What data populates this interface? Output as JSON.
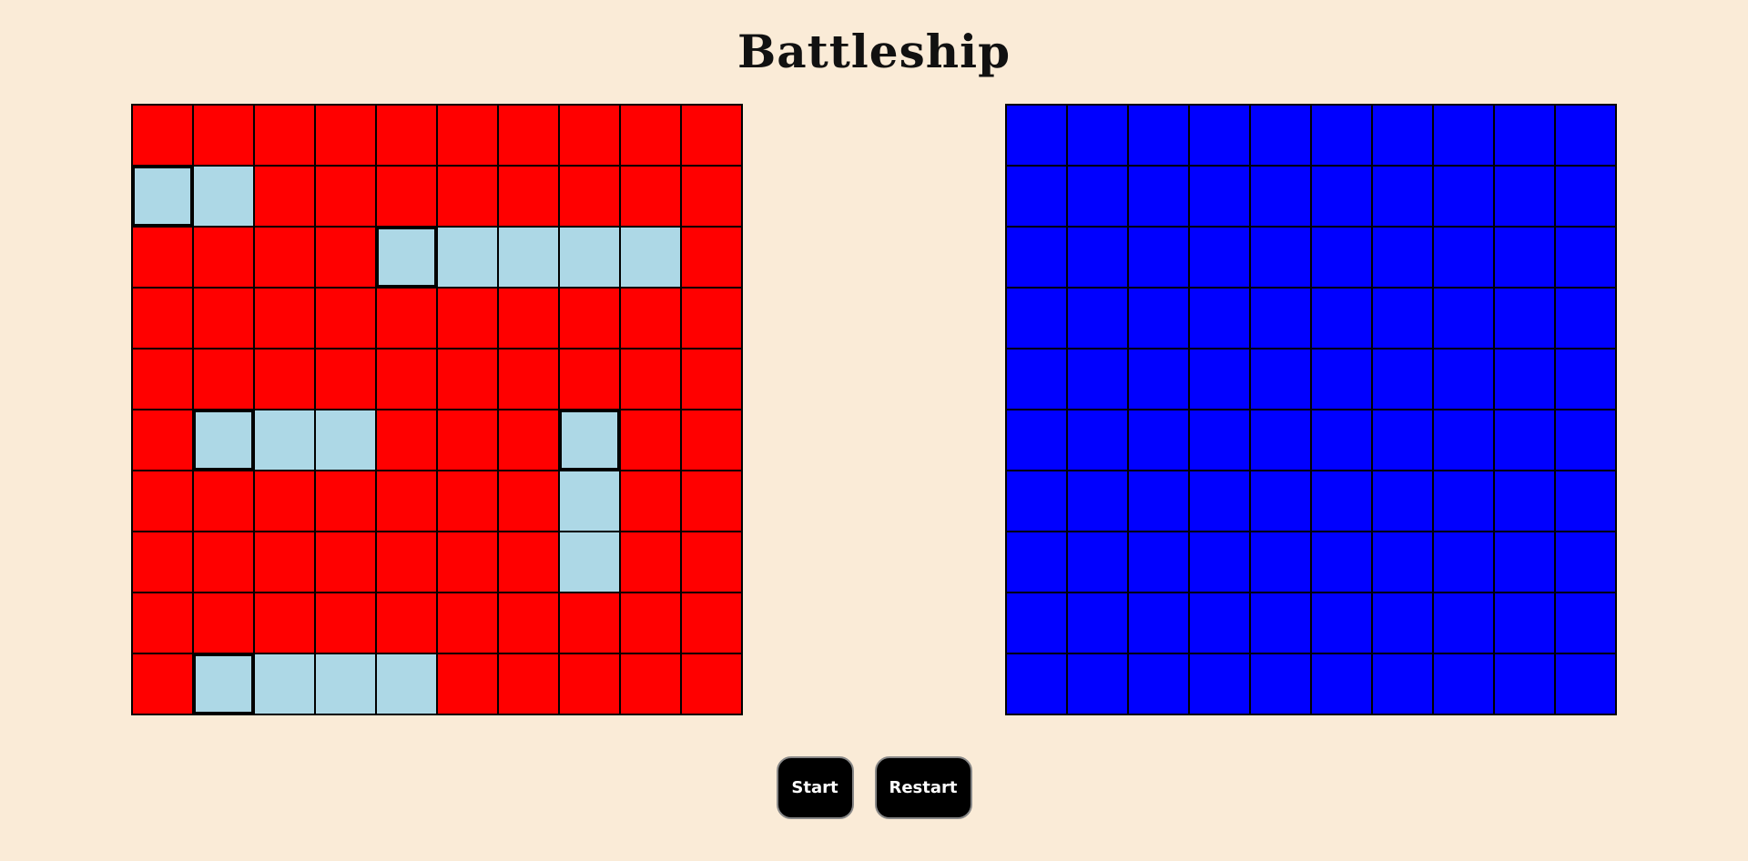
{
  "title": "Battleship",
  "colors": {
    "background": "#faebd7",
    "player_water": "#ff0000",
    "ship": "#add8e6",
    "computer_water": "#0000ff",
    "button_bg": "#000000",
    "button_text": "#ffffff"
  },
  "player_board": {
    "rows": 10,
    "cols": 10,
    "ships": [
      {
        "cells": [
          [
            1,
            0
          ],
          [
            1,
            1
          ]
        ]
      },
      {
        "cells": [
          [
            2,
            4
          ],
          [
            2,
            5
          ],
          [
            2,
            6
          ],
          [
            2,
            7
          ],
          [
            2,
            8
          ]
        ]
      },
      {
        "cells": [
          [
            5,
            1
          ],
          [
            5,
            2
          ],
          [
            5,
            3
          ]
        ]
      },
      {
        "cells": [
          [
            5,
            7
          ],
          [
            6,
            7
          ],
          [
            7,
            7
          ]
        ]
      },
      {
        "cells": [
          [
            9,
            1
          ],
          [
            9,
            2
          ],
          [
            9,
            3
          ],
          [
            9,
            4
          ]
        ]
      }
    ]
  },
  "computer_board": {
    "rows": 10,
    "cols": 10
  },
  "controls": {
    "start_label": "Start",
    "restart_label": "Restart"
  }
}
